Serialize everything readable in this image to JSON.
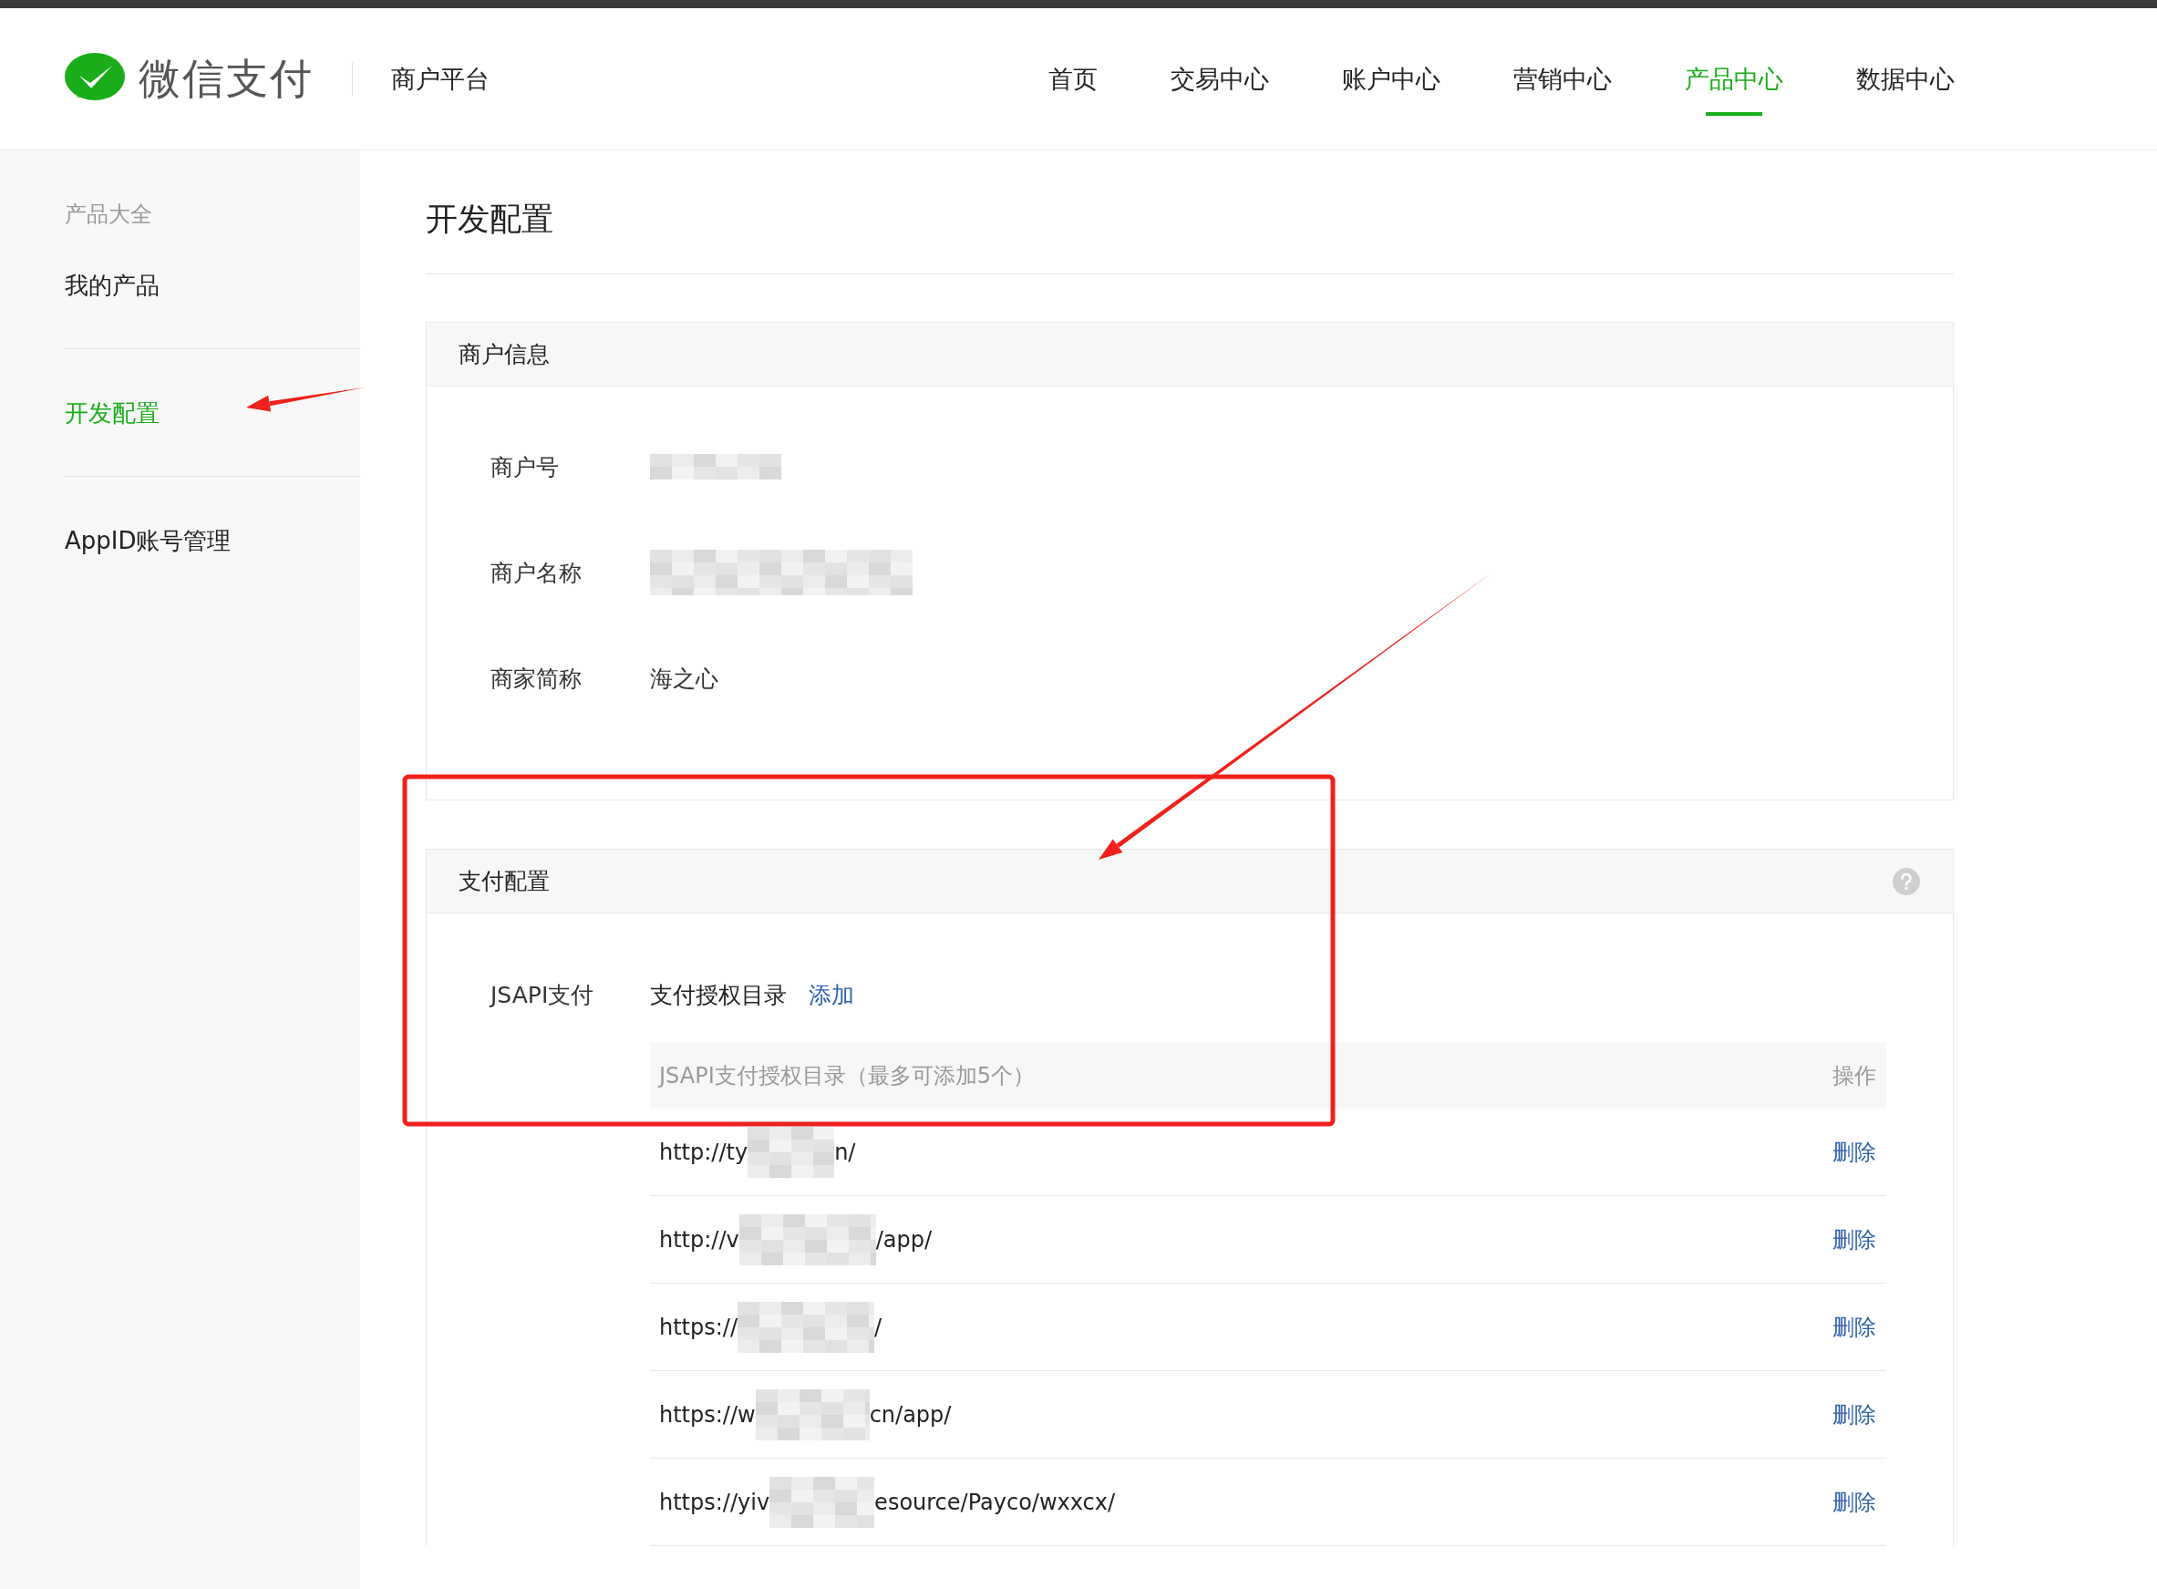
{
  "header": {
    "brand": "微信支付",
    "platform": "商户平台",
    "nav": [
      {
        "label": "首页",
        "selected": false
      },
      {
        "label": "交易中心",
        "selected": false
      },
      {
        "label": "账户中心",
        "selected": false
      },
      {
        "label": "营销中心",
        "selected": false
      },
      {
        "label": "产品中心",
        "selected": true
      },
      {
        "label": "数据中心",
        "selected": false
      }
    ]
  },
  "sidebar": {
    "groups": [
      [
        {
          "label": "产品大全",
          "kind": "heading",
          "selected": false
        },
        {
          "label": "我的产品",
          "kind": "link",
          "selected": false
        }
      ],
      [
        {
          "label": "开发配置",
          "kind": "link",
          "selected": true
        }
      ],
      [
        {
          "label": "AppID账号管理",
          "kind": "link",
          "selected": false
        }
      ]
    ]
  },
  "page_title": "开发配置",
  "merchant_info": {
    "title": "商户信息",
    "fields": [
      {
        "label": "商户号",
        "redacted": true
      },
      {
        "label": "商户名称",
        "redacted": true
      },
      {
        "label": "商家简称",
        "value": "海之心",
        "redacted": false
      }
    ]
  },
  "payment_config": {
    "title": "支付配置",
    "method": "JSAPI支付",
    "directory_label": "支付授权目录",
    "add_link": "添加",
    "table": {
      "columns": [
        "JSAPI支付授权目录（最多可添加5个）",
        "操作"
      ],
      "rows": [
        {
          "prefix": "http://ty",
          "suffix": "n/",
          "action": "删除"
        },
        {
          "prefix": "http://v",
          "suffix": "/app/",
          "action": "删除"
        },
        {
          "prefix": "https://",
          "suffix": "/",
          "action": "删除"
        },
        {
          "prefix": "https://w",
          "suffix": "cn/app/",
          "action": "删除"
        },
        {
          "prefix": "https://yiv",
          "suffix": "esource/Payco/wxxcx/",
          "action": "删除"
        }
      ]
    }
  },
  "annotations": [
    {
      "kind": "arrow"
    },
    {
      "kind": "arrow"
    },
    {
      "kind": "box"
    }
  ]
}
